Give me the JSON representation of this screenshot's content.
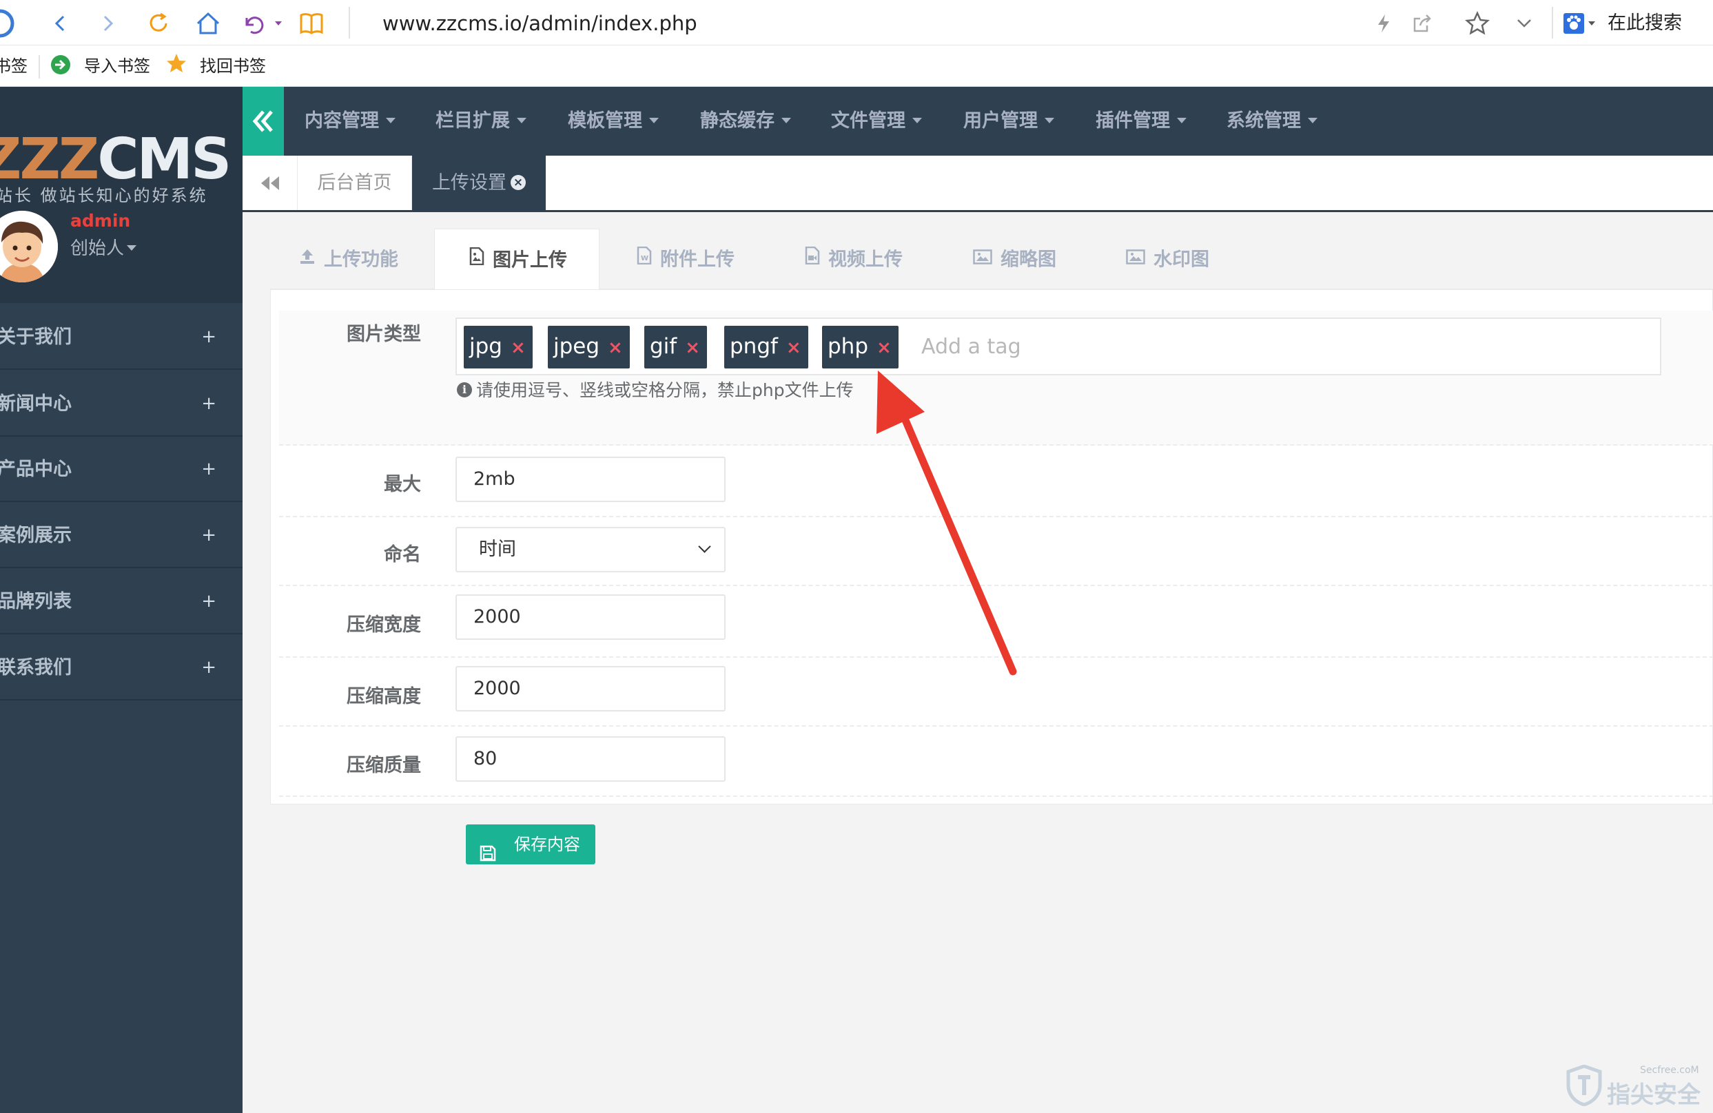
{
  "browser": {
    "url": "www.zzcms.io/admin/index.php",
    "search_label": "在此搜索"
  },
  "bookmarks": {
    "cut_label": "书签",
    "import_label": "导入书签",
    "retrieve_label": "找回书签"
  },
  "sidebar": {
    "logo_primary": "ZZZ",
    "logo_secondary": "CMS",
    "slogan": "站长 做站长知心的好系统",
    "user_name": "admin",
    "user_role": "创始人",
    "menu": [
      {
        "label": "关于我们",
        "plus": "+"
      },
      {
        "label": "新闻中心",
        "plus": "+"
      },
      {
        "label": "产品中心",
        "plus": "+"
      },
      {
        "label": "案例展示",
        "plus": "+"
      },
      {
        "label": "品牌列表",
        "plus": "+"
      },
      {
        "label": "联系我们",
        "plus": "+"
      }
    ]
  },
  "topnav": {
    "items": [
      "内容管理",
      "栏目扩展",
      "模板管理",
      "静态缓存",
      "文件管理",
      "用户管理",
      "插件管理",
      "系统管理"
    ]
  },
  "tabs": {
    "home": "后台首页",
    "active": "上传设置"
  },
  "subtabs": [
    "上传功能",
    "图片上传",
    "附件上传",
    "视频上传",
    "缩略图",
    "水印图"
  ],
  "form": {
    "image_types": {
      "label": "图片类型",
      "tags": [
        "jpg",
        "jpeg",
        "gif",
        "pngf",
        "php"
      ],
      "placeholder": "Add a tag",
      "help": "请使用逗号、竖线或空格分隔，禁止php文件上传"
    },
    "max": {
      "label": "最大",
      "value": "2mb"
    },
    "naming": {
      "label": "命名",
      "value": "时间"
    },
    "width": {
      "label": "压缩宽度",
      "value": "2000"
    },
    "height": {
      "label": "压缩高度",
      "value": "2000"
    },
    "quality": {
      "label": "压缩质量",
      "value": "80"
    }
  },
  "save_label": "保存内容",
  "watermark": {
    "text": "指尖安全",
    "small": "Secfree.coM"
  },
  "colors": {
    "accent": "#1ab394",
    "nav": "#2f4050",
    "danger": "#ed5565",
    "annotation": "#e8392c"
  }
}
